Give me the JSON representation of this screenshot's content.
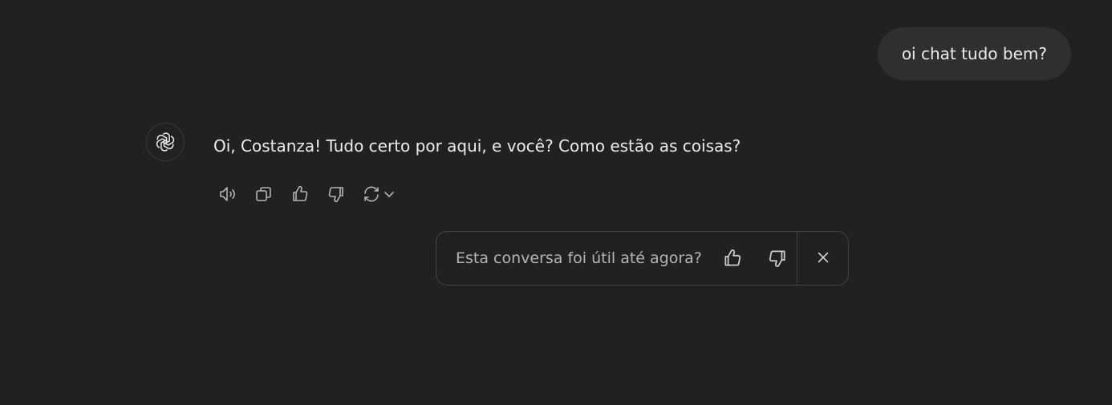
{
  "user_message": {
    "text": "oi chat tudo bem?"
  },
  "assistant": {
    "avatar_icon": "openai-logo-icon",
    "message": "Oi, Costanza! Tudo certo por aqui, e você? Como estão as coisas?",
    "actions": [
      {
        "icon": "speaker-icon"
      },
      {
        "icon": "copy-icon"
      },
      {
        "icon": "thumbs-up-icon"
      },
      {
        "icon": "thumbs-down-icon"
      },
      {
        "icon": "regenerate-icon"
      }
    ]
  },
  "feedback": {
    "question": "Esta conversa foi útil até agora?",
    "up_icon": "thumbs-up-icon",
    "down_icon": "thumbs-down-icon",
    "close_icon": "close-icon"
  },
  "colors": {
    "background": "#212121",
    "bubble": "#2f2f2f",
    "text": "#ececec",
    "muted_text": "#b4b4b4",
    "border": "#444444"
  }
}
